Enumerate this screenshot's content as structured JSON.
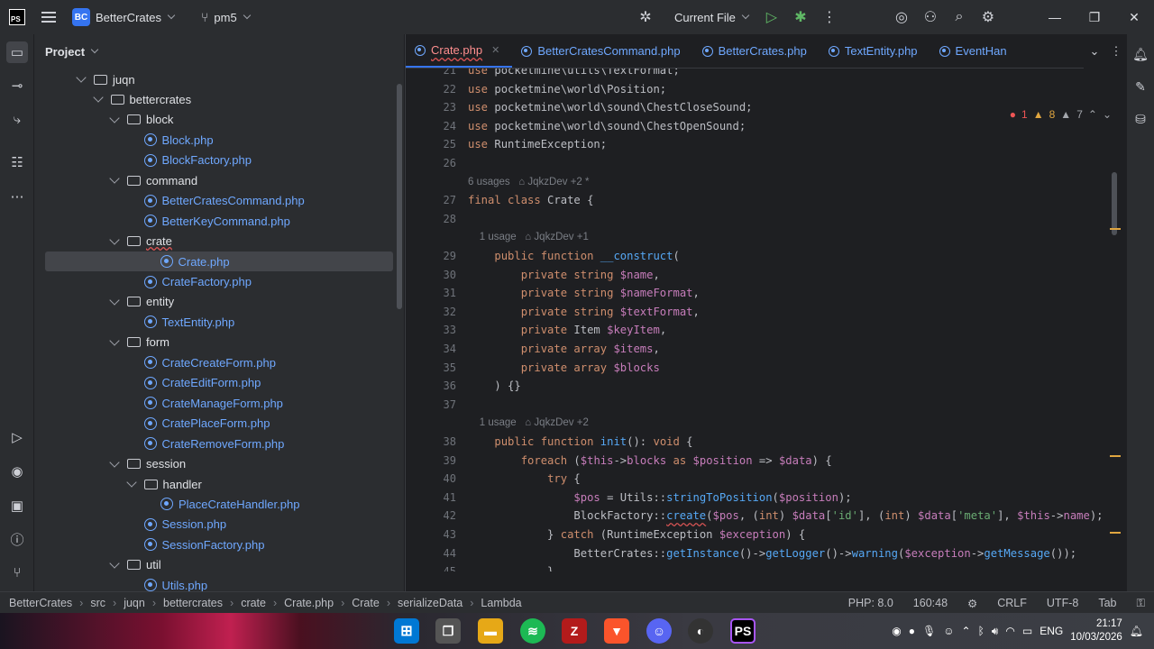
{
  "window": {
    "project_name": "BetterCrates",
    "project_badge": "BC",
    "branch": "pm5",
    "run_config": "Current File",
    "logo_text": "PS"
  },
  "project_panel": {
    "title": "Project",
    "tree": [
      {
        "label": "juqn",
        "type": "folder",
        "depth": 0,
        "expanded": true
      },
      {
        "label": "bettercrates",
        "type": "folder",
        "depth": 1,
        "expanded": true
      },
      {
        "label": "block",
        "type": "folder",
        "depth": 2,
        "expanded": true
      },
      {
        "label": "Block.php",
        "type": "php",
        "depth": 3
      },
      {
        "label": "BlockFactory.php",
        "type": "php",
        "depth": 3
      },
      {
        "label": "command",
        "type": "folder",
        "depth": 2,
        "expanded": true
      },
      {
        "label": "BetterCratesCommand.php",
        "type": "php",
        "depth": 3
      },
      {
        "label": "BetterKeyCommand.php",
        "type": "php",
        "depth": 3
      },
      {
        "label": "crate",
        "type": "folder",
        "depth": 2,
        "expanded": true
      },
      {
        "label": "Crate.php",
        "type": "php",
        "depth": 3,
        "selected": true
      },
      {
        "label": "CrateFactory.php",
        "type": "php",
        "depth": 3
      },
      {
        "label": "entity",
        "type": "folder",
        "depth": 2,
        "expanded": true
      },
      {
        "label": "TextEntity.php",
        "type": "php",
        "depth": 3
      },
      {
        "label": "form",
        "type": "folder",
        "depth": 2,
        "expanded": true
      },
      {
        "label": "CrateCreateForm.php",
        "type": "php",
        "depth": 3
      },
      {
        "label": "CrateEditForm.php",
        "type": "php",
        "depth": 3
      },
      {
        "label": "CrateManageForm.php",
        "type": "php",
        "depth": 3
      },
      {
        "label": "CratePlaceForm.php",
        "type": "php",
        "depth": 3
      },
      {
        "label": "CrateRemoveForm.php",
        "type": "php",
        "depth": 3
      },
      {
        "label": "session",
        "type": "folder",
        "depth": 2,
        "expanded": true
      },
      {
        "label": "handler",
        "type": "folder",
        "depth": 3,
        "expanded": true
      },
      {
        "label": "PlaceCrateHandler.php",
        "type": "php",
        "depth": 4
      },
      {
        "label": "Session.php",
        "type": "php",
        "depth": 3
      },
      {
        "label": "SessionFactory.php",
        "type": "php",
        "depth": 3
      },
      {
        "label": "util",
        "type": "folder",
        "depth": 2,
        "expanded": true
      },
      {
        "label": "Utils.php",
        "type": "php",
        "depth": 3
      }
    ]
  },
  "tabs": [
    {
      "label": "Crate.php",
      "active": true
    },
    {
      "label": "BetterCratesCommand.php"
    },
    {
      "label": "BetterCrates.php"
    },
    {
      "label": "TextEntity.php"
    },
    {
      "label": "EventHan"
    }
  ],
  "inspections": {
    "errors": "1",
    "warnings": "8",
    "typos": "7"
  },
  "code_lines": [
    {
      "n": "21",
      "html": "<span class=\"kw\">use</span> pocketmine\\utils\\TextFormat;"
    },
    {
      "n": "22",
      "html": "<span class=\"kw\">use</span> pocketmine\\world\\Position;"
    },
    {
      "n": "23",
      "html": "<span class=\"kw\">use</span> pocketmine\\world\\sound\\ChestCloseSound;"
    },
    {
      "n": "24",
      "html": "<span class=\"kw\">use</span> pocketmine\\world\\sound\\ChestOpenSound;"
    },
    {
      "n": "25",
      "html": "<span class=\"kw\">use</span> RuntimeException;"
    },
    {
      "n": "26",
      "html": ""
    },
    {
      "hint": "6 usages   ⌂ JqkzDev +2 *"
    },
    {
      "n": "27",
      "html": "<span class=\"kw\">final class</span> Crate {"
    },
    {
      "n": "28",
      "html": ""
    },
    {
      "hint": "    1 usage   ⌂ JqkzDev +1"
    },
    {
      "n": "29",
      "html": "    <span class=\"kw\">public function</span> <span class=\"fn\">__construct</span>("
    },
    {
      "n": "30",
      "html": "        <span class=\"kw\">private string</span> <span class=\"var\">$name</span>,"
    },
    {
      "n": "31",
      "html": "        <span class=\"kw\">private string</span> <span class=\"var\">$nameFormat</span>,"
    },
    {
      "n": "32",
      "html": "        <span class=\"kw\">private string</span> <span class=\"var\">$textFormat</span>,"
    },
    {
      "n": "33",
      "html": "        <span class=\"kw\">private</span> Item <span class=\"var\">$keyItem</span>,"
    },
    {
      "n": "34",
      "html": "        <span class=\"kw\">private array</span> <span class=\"var\">$items</span>,"
    },
    {
      "n": "35",
      "html": "        <span class=\"kw\">private array</span> <span class=\"var\">$blocks</span>"
    },
    {
      "n": "36",
      "html": "    ) {}"
    },
    {
      "n": "37",
      "html": ""
    },
    {
      "hint": "    1 usage   ⌂ JqkzDev +2"
    },
    {
      "n": "38",
      "html": "    <span class=\"kw\">public function</span> <span class=\"fn\">init</span>(): <span class=\"kw\">void</span> {"
    },
    {
      "n": "39",
      "html": "        <span class=\"kw\">foreach</span> (<span class=\"var\">$this</span>-><span class=\"var\">blocks</span> <span class=\"kw\">as</span> <span class=\"var\">$position</span> => <span class=\"var\">$data</span>) {"
    },
    {
      "n": "40",
      "html": "            <span class=\"kw\">try</span> {"
    },
    {
      "n": "41",
      "html": "                <span class=\"var\">$pos</span> = Utils::<span class=\"fn\">stringToPosition</span>(<span class=\"var\">$position</span>);"
    },
    {
      "n": "42",
      "html": "                BlockFactory::<span class=\"fn err\">create</span>(<span class=\"var\">$pos</span>, (<span class=\"kw\">int</span>) <span class=\"var\">$data</span>[<span class=\"str\">'id'</span>], (<span class=\"kw\">int</span>) <span class=\"var\">$data</span>[<span class=\"str\">'meta'</span>], <span class=\"var\">$this</span>-><span class=\"var\">name</span>);"
    },
    {
      "n": "43",
      "html": "            } <span class=\"kw\">catch</span> (RuntimeException <span class=\"var\">$exception</span>) {"
    },
    {
      "n": "44",
      "html": "                BetterCrates::<span class=\"fn\">getInstance</span>()-><span class=\"fn\">getLogger</span>()-><span class=\"fn\">warning</span>(<span class=\"var\">$exception</span>-><span class=\"fn\">getMessage</span>());"
    },
    {
      "n": "45",
      "html": "            }"
    }
  ],
  "code_breadcrumb": [
    "\\juqn\\bettercrates\\crate",
    "Crate",
    "serializeData()",
    "λ()"
  ],
  "status": {
    "path": [
      "BetterCrates",
      "src",
      "juqn",
      "bettercrates",
      "crate",
      "Crate.php",
      "Crate",
      "serializeData",
      "Lambda"
    ],
    "php_version": "PHP: 8.0",
    "position": "160:48",
    "line_sep": "CRLF",
    "encoding": "UTF-8",
    "indent": "Tab"
  },
  "taskbar": {
    "language": "ENG",
    "time": "21:17",
    "date": "10/03/2026"
  }
}
